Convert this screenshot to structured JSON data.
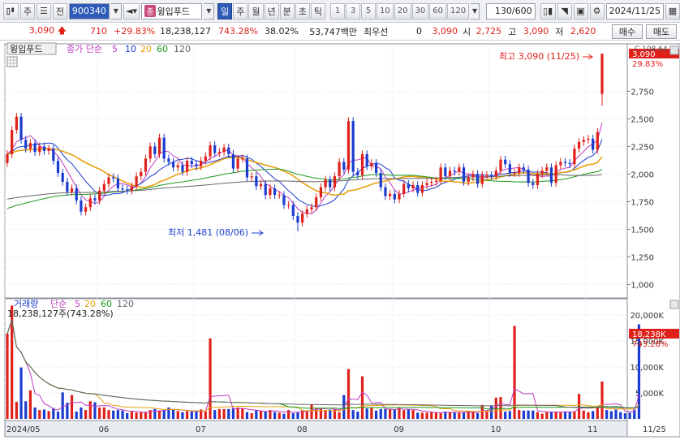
{
  "toolbar": {
    "menu_label": "주",
    "prev_label": "전",
    "code": "900340",
    "name_badge": "종",
    "name": "윙입푸드",
    "periods": [
      "일",
      "주",
      "월",
      "년",
      "분",
      "초",
      "틱"
    ],
    "active_period": "일",
    "intervals": [
      "1",
      "3",
      "5",
      "10",
      "20",
      "30",
      "60",
      "120"
    ],
    "count": "130/600",
    "date": "2024/11/25"
  },
  "quote": {
    "price": "3,090",
    "change": "710",
    "change_pct": "+29.83%",
    "volume": "18,238,127",
    "volume_ratio": "743.28%",
    "turnover": "38.02%",
    "amount": "53,747백만",
    "preferred_label": "최우선",
    "preferred_value": "0",
    "last": "3,090",
    "open_label": "시",
    "open": "2,725",
    "high_label": "고",
    "high": "3,090",
    "low_label": "저",
    "low": "2,620",
    "buy_label": "매수",
    "sell_label": "매도"
  },
  "price_panel": {
    "stock_tag": "윙입푸드",
    "indicator_label": "종가 단순",
    "ma_periods": [
      "5",
      "10",
      "20",
      "60",
      "120"
    ],
    "max_label": "최고 3,090 (11/25)",
    "min_label": "최저 1,481 (08/06)",
    "price_box": "3,090",
    "pct_box": "29.83%",
    "corner_label": "C 108.64"
  },
  "volume_panel": {
    "label": "거래량",
    "indicator_label": "단순",
    "ma_periods": [
      "5",
      "20",
      "60",
      "120"
    ],
    "current": "18,238,127주(743.28%)",
    "vol_box": "18,238K",
    "pct_box": "743.28%"
  },
  "colors": {
    "up": "#e0201a",
    "down": "#1a3cd0",
    "ma5": "#c03ac0",
    "ma10": "#1a3cd0",
    "ma20": "#e8a010",
    "ma60": "#1a9a1a",
    "ma120": "#666666"
  },
  "chart_data": [
    {
      "type": "candlestick",
      "title": "",
      "ylim": [
        900,
        3150
      ],
      "y_ticks": [
        1000,
        1250,
        1500,
        1750,
        2000,
        2250,
        2500,
        2750
      ],
      "x_months": [
        "2024/05",
        "06",
        "07",
        "08",
        "09",
        "10",
        "11",
        "11/25"
      ],
      "closes": [
        2180,
        2400,
        2520,
        2310,
        2230,
        2280,
        2200,
        2250,
        2210,
        2230,
        2120,
        2010,
        1930,
        1840,
        1870,
        1760,
        1660,
        1700,
        1780,
        1760,
        1850,
        1910,
        1970,
        1960,
        1870,
        1860,
        1850,
        1890,
        1980,
        2020,
        2140,
        2250,
        2180,
        2330,
        2140,
        2110,
        2060,
        2080,
        2020,
        2120,
        2090,
        2070,
        2120,
        2160,
        2260,
        2190,
        2200,
        2240,
        2180,
        2050,
        2140,
        2140,
        1970,
        1980,
        1890,
        1910,
        1810,
        1870,
        1810,
        1810,
        1720,
        1720,
        1620,
        1560,
        1640,
        1680,
        1700,
        1790,
        1880,
        1950,
        1880,
        1980,
        2110,
        2040,
        2480,
        2020,
        1990,
        2180,
        2070,
        2100,
        2010,
        1880,
        1800,
        1820,
        1770,
        1820,
        1910,
        1870,
        1900,
        1830,
        1900,
        1920,
        1930,
        1940,
        2060,
        1980,
        2030,
        2020,
        2060,
        1930,
        1970,
        2000,
        1910,
        1990,
        1990,
        1980,
        2030,
        2130,
        2090,
        2010,
        2010,
        2060,
        2040,
        1920,
        1900,
        2000,
        2030,
        2060,
        1920,
        2080,
        2110,
        2100,
        2090,
        2230,
        2290,
        2310,
        2320,
        2220,
        2380,
        3090
      ],
      "max": {
        "value": 3090,
        "date": "11/25"
      },
      "min": {
        "value": 1481,
        "date": "08/06"
      },
      "ma_periods": [
        5,
        10,
        20,
        60,
        120
      ]
    },
    {
      "type": "bar",
      "title": "",
      "ylim": [
        0,
        22500
      ],
      "y_ticks": [
        5000,
        10000,
        15000,
        20000
      ],
      "unit": "K",
      "x_months": [
        "2024/05",
        "06",
        "07",
        "08",
        "09",
        "10",
        "11"
      ],
      "values": [
        16400,
        21800,
        3300,
        9900,
        3400,
        5500,
        2200,
        1700,
        1800,
        1500,
        2100,
        1400,
        5100,
        3100,
        4600,
        1400,
        2200,
        1700,
        3400,
        3200,
        2200,
        2200,
        1700,
        1600,
        1700,
        1600,
        1100,
        1400,
        1200,
        1300,
        1300,
        1700,
        1900,
        1600,
        1700,
        2200,
        1800,
        1500,
        1300,
        1500,
        1400,
        1500,
        1800,
        1400,
        15500,
        1700,
        1900,
        1900,
        1900,
        2100,
        2200,
        2100,
        1300,
        1100,
        1700,
        1600,
        1400,
        1700,
        1300,
        1200,
        1000,
        1700,
        1100,
        1300,
        1700,
        1400,
        2800,
        2000,
        2000,
        1700,
        1800,
        1800,
        1300,
        4600,
        9600,
        1700,
        1400,
        8200,
        2000,
        2200,
        1600,
        1900,
        1900,
        1800,
        1800,
        2200,
        1700,
        1800,
        1700,
        1200,
        1200,
        1200,
        1300,
        1300,
        1100,
        1400,
        1300,
        1300,
        1200,
        1200,
        1500,
        1300,
        1100,
        2700,
        1400,
        2600,
        4100,
        4200,
        1400,
        1500,
        17900,
        1700,
        1600,
        1600,
        1600,
        1300,
        1000,
        1300,
        1400,
        1400,
        1300,
        1400,
        1300,
        1400,
        4800,
        1600,
        1300,
        1500,
        2300,
        7200,
        1700,
        1500,
        1800,
        1300,
        1100,
        1200,
        1800,
        18200
      ]
    }
  ]
}
